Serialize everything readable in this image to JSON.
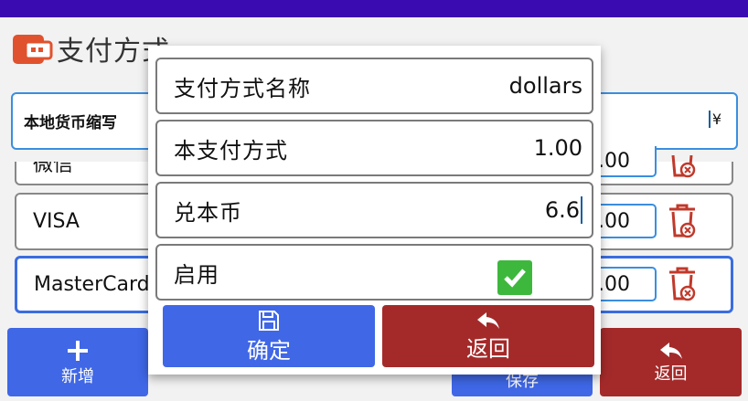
{
  "header": {
    "title": "支付方式"
  },
  "currency_row": {
    "label": "本地货币缩写",
    "value": "¥"
  },
  "payment_list": [
    {
      "name": "微信",
      "rate": ".00"
    },
    {
      "name": "VISA",
      "rate": ".00"
    },
    {
      "name": "MasterCard",
      "rate": ".00"
    }
  ],
  "bottom_buttons": {
    "add_label": "新增",
    "save_label": "保存",
    "back_label": "返回"
  },
  "dialog": {
    "name_label": "支付方式名称",
    "name_value": "dollars",
    "amount_label": "本支付方式",
    "amount_value": "1.00",
    "rate_label": "兑本币",
    "rate_value": "6.6",
    "enabled_label": "启用",
    "ok_label": "确定",
    "back_label": "返回"
  },
  "colors": {
    "status_bar": "#3a0bb0",
    "primary": "#3f67e6",
    "danger": "#a42a2a",
    "check": "#3db83d"
  }
}
